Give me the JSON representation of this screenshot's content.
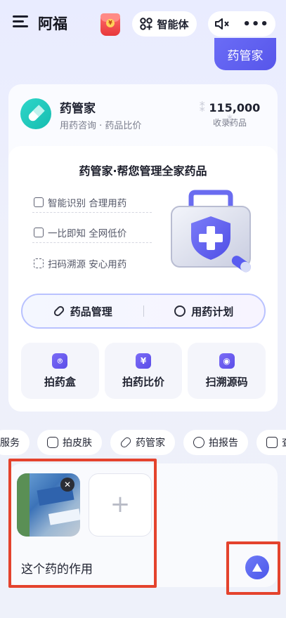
{
  "header": {
    "app_title": "阿福",
    "agent_label": "智能体",
    "more_label": "•••",
    "redpacket_symbol": "¥"
  },
  "user_message": "药管家",
  "agent_card": {
    "name": "药管家",
    "subtitle": "用药咨询 · 药品比价",
    "stat_value": "115,000",
    "stat_label": "收录药品",
    "panel_title": "药管家·帮您管理全家药品",
    "features": [
      {
        "label": "智能识别 合理用药",
        "icon": "camera-icon"
      },
      {
        "label": "一比即知 全网低价",
        "icon": "document-icon"
      },
      {
        "label": "扫码溯源 安心用药",
        "icon": "scan-icon"
      }
    ],
    "tabs": [
      {
        "label": "药品管理",
        "icon": "pill-icon"
      },
      {
        "label": "用药计划",
        "icon": "clock-icon"
      }
    ],
    "tools": [
      {
        "label": "拍药盒",
        "icon_glyph": "⌾"
      },
      {
        "label": "拍药比价",
        "icon_glyph": "¥"
      },
      {
        "label": "扫溯源码",
        "icon_glyph": "◉"
      }
    ]
  },
  "chips": [
    {
      "label": "服务"
    },
    {
      "label": "拍皮肤"
    },
    {
      "label": "药管家"
    },
    {
      "label": "拍报告"
    },
    {
      "label": "查"
    }
  ],
  "input": {
    "query": "这个药的作用",
    "add_symbol": "+",
    "close_symbol": "✕"
  },
  "colors": {
    "accent": "#5b5cf0",
    "highlight": "#e4432d",
    "teal": "#1fc8bb"
  }
}
